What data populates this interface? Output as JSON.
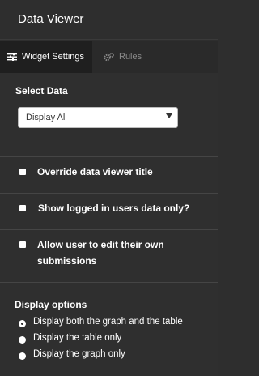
{
  "header": {
    "title": "Data Viewer"
  },
  "tabs": [
    {
      "label": "Widget Settings",
      "icon": "sliders-icon",
      "active": true
    },
    {
      "label": "Rules",
      "icon": "gears-icon",
      "active": false
    }
  ],
  "select_data": {
    "label": "Select Data",
    "value": "Display All"
  },
  "checkboxes": [
    {
      "label": "Override data viewer title",
      "checked": false
    },
    {
      "label": "Show logged in users data only?",
      "checked": false
    },
    {
      "label_line1": "Allow user to edit their own",
      "label_line2": "submissions",
      "checked": false
    }
  ],
  "display_options": {
    "label": "Display options",
    "options": [
      {
        "label": "Display both the graph and the table",
        "selected": true
      },
      {
        "label": "Display the table only",
        "selected": false
      },
      {
        "label": "Display the graph only",
        "selected": false
      }
    ]
  }
}
